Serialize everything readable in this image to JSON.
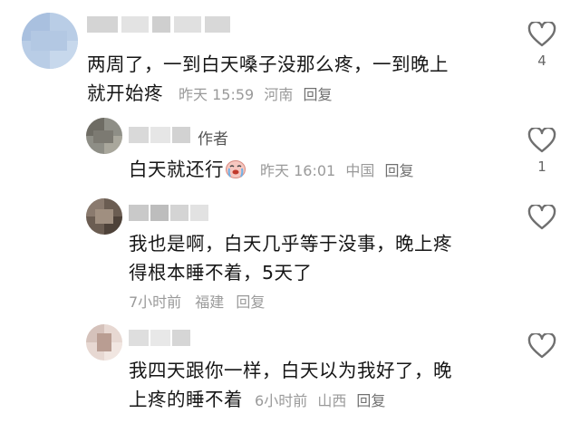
{
  "comments": [
    {
      "text_line1": "两周了，一到白天嗓子没那么疼，一到晚上",
      "text_line2": "就开始疼",
      "time": "昨天 15:59",
      "location": "河南",
      "reply": "回复",
      "likes": "4"
    },
    {
      "author_tag": "作者",
      "text": "白天就还行",
      "emoji": "crying-face-emoji",
      "time": "昨天 16:01",
      "location": "中国",
      "reply": "回复",
      "likes": "1"
    },
    {
      "text_line1": "我也是啊，白天几乎等于没事，晚上疼",
      "text_line2": "得根本睡不着，5天了",
      "time": "7小时前",
      "location": "福建",
      "reply": "回复"
    },
    {
      "text_line1": "我四天跟你一样，白天以为我好了，晚",
      "text_line2": "上疼的睡不着",
      "time": "6小时前",
      "location": "山西",
      "reply": "回复"
    }
  ],
  "colors": {
    "text": "#161616",
    "meta": "#9a9a9a",
    "heart": "#6f6f6f"
  },
  "icons": {
    "like": "heart-outline-icon"
  }
}
